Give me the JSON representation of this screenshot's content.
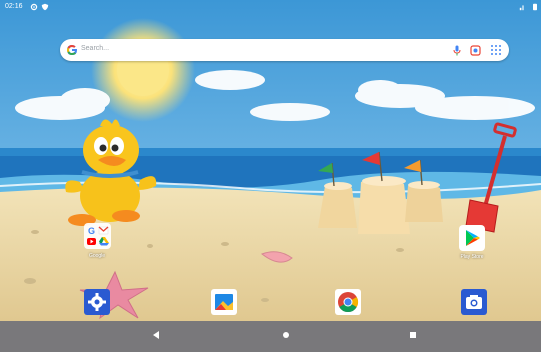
{
  "status_bar": {
    "time": "02:16",
    "icons": [
      "gear-icon",
      "shield-icon",
      "signal-icon",
      "battery-icon"
    ]
  },
  "search": {
    "placeholder": "Search...",
    "icons": [
      "google-g-icon",
      "microphone-icon",
      "lens-icon",
      "apps-grid-icon"
    ]
  },
  "home": {
    "folder": {
      "label": "Google",
      "apps": [
        "google",
        "gmail",
        "youtube",
        "drive"
      ]
    },
    "play_store": {
      "label": "Play Store"
    }
  },
  "dock": {
    "apps": [
      "settings",
      "gallery",
      "chrome",
      "camera"
    ]
  },
  "nav": {
    "buttons": [
      "back",
      "home",
      "recents"
    ]
  },
  "colors": {
    "sky": "#4aa9e0",
    "sea": "#1d6fb8",
    "sand": "#e9d5a1",
    "nav": "#79787b"
  }
}
